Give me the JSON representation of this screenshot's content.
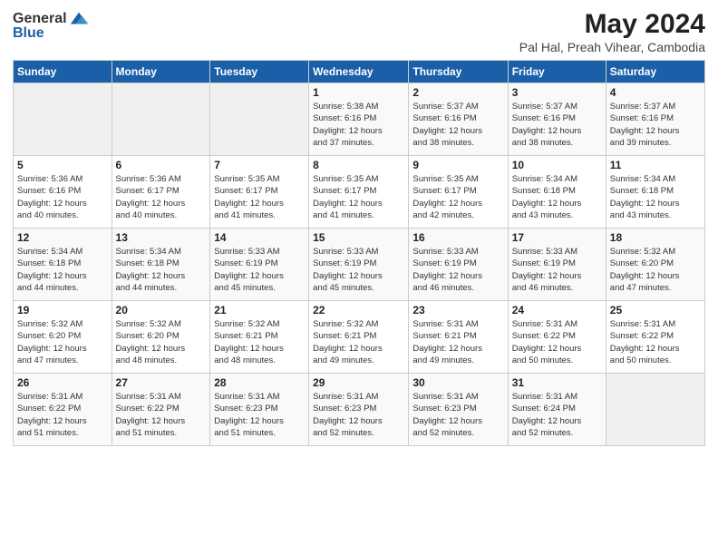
{
  "logo": {
    "text_general": "General",
    "text_blue": "Blue"
  },
  "title": "May 2024",
  "subtitle": "Pal Hal, Preah Vihear, Cambodia",
  "header_days": [
    "Sunday",
    "Monday",
    "Tuesday",
    "Wednesday",
    "Thursday",
    "Friday",
    "Saturday"
  ],
  "weeks": [
    [
      {
        "day": "",
        "info": ""
      },
      {
        "day": "",
        "info": ""
      },
      {
        "day": "",
        "info": ""
      },
      {
        "day": "1",
        "info": "Sunrise: 5:38 AM\nSunset: 6:16 PM\nDaylight: 12 hours\nand 37 minutes."
      },
      {
        "day": "2",
        "info": "Sunrise: 5:37 AM\nSunset: 6:16 PM\nDaylight: 12 hours\nand 38 minutes."
      },
      {
        "day": "3",
        "info": "Sunrise: 5:37 AM\nSunset: 6:16 PM\nDaylight: 12 hours\nand 38 minutes."
      },
      {
        "day": "4",
        "info": "Sunrise: 5:37 AM\nSunset: 6:16 PM\nDaylight: 12 hours\nand 39 minutes."
      }
    ],
    [
      {
        "day": "5",
        "info": "Sunrise: 5:36 AM\nSunset: 6:16 PM\nDaylight: 12 hours\nand 40 minutes."
      },
      {
        "day": "6",
        "info": "Sunrise: 5:36 AM\nSunset: 6:17 PM\nDaylight: 12 hours\nand 40 minutes."
      },
      {
        "day": "7",
        "info": "Sunrise: 5:35 AM\nSunset: 6:17 PM\nDaylight: 12 hours\nand 41 minutes."
      },
      {
        "day": "8",
        "info": "Sunrise: 5:35 AM\nSunset: 6:17 PM\nDaylight: 12 hours\nand 41 minutes."
      },
      {
        "day": "9",
        "info": "Sunrise: 5:35 AM\nSunset: 6:17 PM\nDaylight: 12 hours\nand 42 minutes."
      },
      {
        "day": "10",
        "info": "Sunrise: 5:34 AM\nSunset: 6:18 PM\nDaylight: 12 hours\nand 43 minutes."
      },
      {
        "day": "11",
        "info": "Sunrise: 5:34 AM\nSunset: 6:18 PM\nDaylight: 12 hours\nand 43 minutes."
      }
    ],
    [
      {
        "day": "12",
        "info": "Sunrise: 5:34 AM\nSunset: 6:18 PM\nDaylight: 12 hours\nand 44 minutes."
      },
      {
        "day": "13",
        "info": "Sunrise: 5:34 AM\nSunset: 6:18 PM\nDaylight: 12 hours\nand 44 minutes."
      },
      {
        "day": "14",
        "info": "Sunrise: 5:33 AM\nSunset: 6:19 PM\nDaylight: 12 hours\nand 45 minutes."
      },
      {
        "day": "15",
        "info": "Sunrise: 5:33 AM\nSunset: 6:19 PM\nDaylight: 12 hours\nand 45 minutes."
      },
      {
        "day": "16",
        "info": "Sunrise: 5:33 AM\nSunset: 6:19 PM\nDaylight: 12 hours\nand 46 minutes."
      },
      {
        "day": "17",
        "info": "Sunrise: 5:33 AM\nSunset: 6:19 PM\nDaylight: 12 hours\nand 46 minutes."
      },
      {
        "day": "18",
        "info": "Sunrise: 5:32 AM\nSunset: 6:20 PM\nDaylight: 12 hours\nand 47 minutes."
      }
    ],
    [
      {
        "day": "19",
        "info": "Sunrise: 5:32 AM\nSunset: 6:20 PM\nDaylight: 12 hours\nand 47 minutes."
      },
      {
        "day": "20",
        "info": "Sunrise: 5:32 AM\nSunset: 6:20 PM\nDaylight: 12 hours\nand 48 minutes."
      },
      {
        "day": "21",
        "info": "Sunrise: 5:32 AM\nSunset: 6:21 PM\nDaylight: 12 hours\nand 48 minutes."
      },
      {
        "day": "22",
        "info": "Sunrise: 5:32 AM\nSunset: 6:21 PM\nDaylight: 12 hours\nand 49 minutes."
      },
      {
        "day": "23",
        "info": "Sunrise: 5:31 AM\nSunset: 6:21 PM\nDaylight: 12 hours\nand 49 minutes."
      },
      {
        "day": "24",
        "info": "Sunrise: 5:31 AM\nSunset: 6:22 PM\nDaylight: 12 hours\nand 50 minutes."
      },
      {
        "day": "25",
        "info": "Sunrise: 5:31 AM\nSunset: 6:22 PM\nDaylight: 12 hours\nand 50 minutes."
      }
    ],
    [
      {
        "day": "26",
        "info": "Sunrise: 5:31 AM\nSunset: 6:22 PM\nDaylight: 12 hours\nand 51 minutes."
      },
      {
        "day": "27",
        "info": "Sunrise: 5:31 AM\nSunset: 6:22 PM\nDaylight: 12 hours\nand 51 minutes."
      },
      {
        "day": "28",
        "info": "Sunrise: 5:31 AM\nSunset: 6:23 PM\nDaylight: 12 hours\nand 51 minutes."
      },
      {
        "day": "29",
        "info": "Sunrise: 5:31 AM\nSunset: 6:23 PM\nDaylight: 12 hours\nand 52 minutes."
      },
      {
        "day": "30",
        "info": "Sunrise: 5:31 AM\nSunset: 6:23 PM\nDaylight: 12 hours\nand 52 minutes."
      },
      {
        "day": "31",
        "info": "Sunrise: 5:31 AM\nSunset: 6:24 PM\nDaylight: 12 hours\nand 52 minutes."
      },
      {
        "day": "",
        "info": ""
      }
    ]
  ],
  "colors": {
    "header_bg": "#1a5fa8",
    "header_text": "#ffffff",
    "odd_row": "#f9f9f9",
    "even_row": "#ffffff",
    "empty_cell": "#f0f0f0"
  }
}
